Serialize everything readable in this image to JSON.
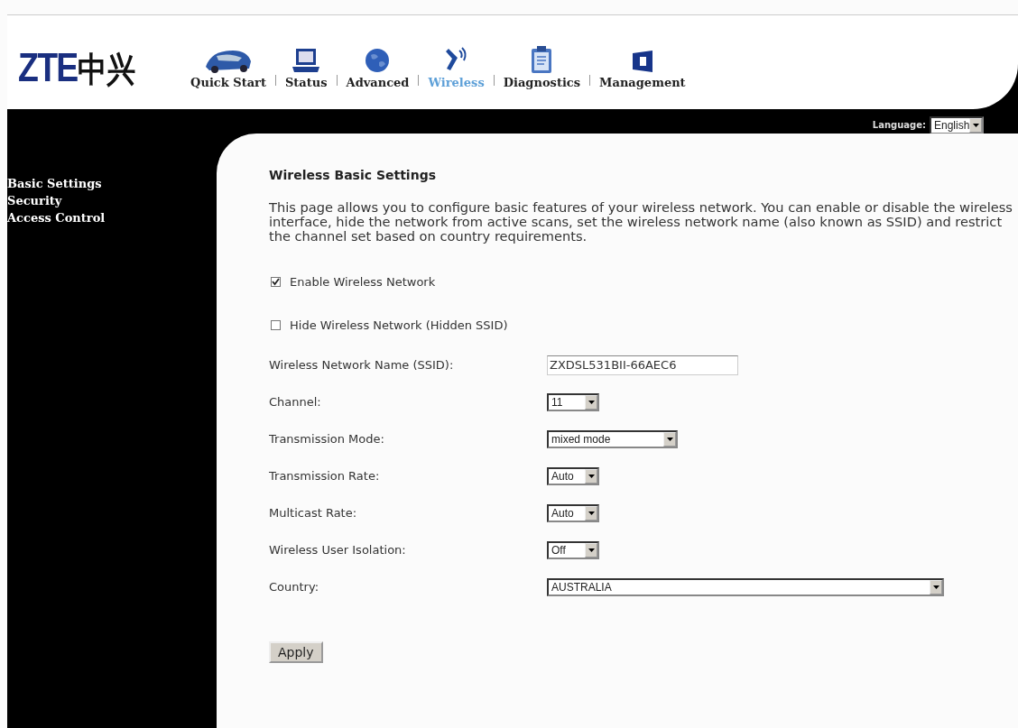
{
  "header": {
    "logo": {
      "latin": "ZTE",
      "chinese": "中兴"
    },
    "nav": [
      {
        "label": "Quick Start",
        "selected": false
      },
      {
        "label": "Status",
        "selected": false
      },
      {
        "label": "Advanced",
        "selected": false
      },
      {
        "label": "Wireless",
        "selected": true
      },
      {
        "label": "Diagnostics",
        "selected": false
      },
      {
        "label": "Management",
        "selected": false
      }
    ],
    "language": {
      "label": "Language:",
      "value": "English"
    }
  },
  "sidebar": {
    "items": [
      {
        "label": "Basic Settings"
      },
      {
        "label": "Security"
      },
      {
        "label": "Access Control"
      }
    ]
  },
  "content": {
    "title": "Wireless Basic Settings",
    "description": "This page allows you to configure basic features of your wireless network. You can enable or disable the wireless interface, hide the network from active scans, set the wireless network name (also known as SSID) and restrict the channel set based on country requirements.",
    "options": [
      {
        "kind": "checkbox",
        "label": "Enable Wireless Network",
        "checked": true
      },
      {
        "kind": "checkbox",
        "label": "Hide Wireless Network (Hidden SSID)",
        "checked": false
      }
    ],
    "fields": [
      {
        "kind": "text",
        "label": "Wireless Network Name (SSID):",
        "value": "ZXDSL531BII-66AEC6"
      },
      {
        "kind": "select",
        "label": "Channel:",
        "value": "11"
      },
      {
        "kind": "select",
        "label": "Transmission Mode:",
        "value": "mixed mode"
      },
      {
        "kind": "select",
        "label": "Transmission Rate:",
        "value": "Auto"
      },
      {
        "kind": "select",
        "label": "Multicast Rate:",
        "value": "Auto"
      },
      {
        "kind": "select",
        "label": "Wireless User Isolation:",
        "value": "Off"
      },
      {
        "kind": "select",
        "label": "Country:",
        "value": "AUSTRALIA"
      }
    ],
    "apply_button": "Apply"
  }
}
